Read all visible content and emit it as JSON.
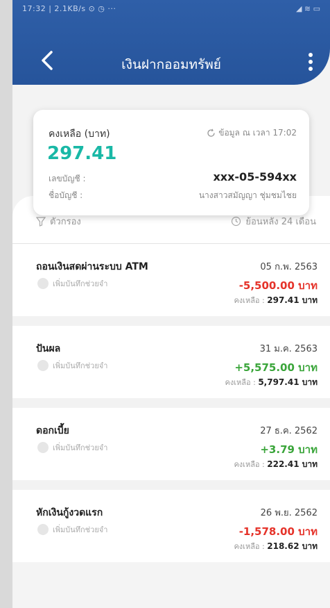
{
  "status_bar": {
    "left": "17:32 | 2.1KB/s ⊙ ◷ ···",
    "right": "◢ ≋ ▭"
  },
  "header": {
    "title": "เงินฝากออมทรัพย์"
  },
  "balance_card": {
    "label": "คงเหลือ (บาท)",
    "refresh_text": "ข้อมูล ณ เวลา 17:02",
    "amount": "297.41",
    "account_no_label": "เลขบัญชี :",
    "account_no": "xxx-05-594xx",
    "account_name_label": "ชื่อบัญชี :",
    "account_name": "นางสาวสมัญญา ชุ่มชมไชย"
  },
  "filters": {
    "filter_label": "ตัวกรอง",
    "period_label": "ย้อนหลัง 24 เดือน"
  },
  "transactions": [
    {
      "name": "ถอนเงินสดผ่านระบบ ATM",
      "date": "05 ก.พ. 2563",
      "note": "เพิ่มบันทึกช่วยจำ",
      "amount": "-5,500.00 บาท",
      "balance_label": "คงเหลือ :",
      "balance": "297.41 บาท",
      "direction": "debit"
    },
    {
      "name": "ปันผล",
      "date": "31 ม.ค. 2563",
      "note": "เพิ่มบันทึกช่วยจำ",
      "amount": "+5,575.00 บาท",
      "balance_label": "คงเหลือ :",
      "balance": "5,797.41 บาท",
      "direction": "credit"
    },
    {
      "name": "ดอกเบี้ย",
      "date": "27 ธ.ค. 2562",
      "note": "เพิ่มบันทึกช่วยจำ",
      "amount": "+3.79 บาท",
      "balance_label": "คงเหลือ :",
      "balance": "222.41 บาท",
      "direction": "credit"
    },
    {
      "name": "หักเงินกู้งวดแรก",
      "date": "26 พ.ย. 2562",
      "note": "เพิ่มบันทึกช่วยจำ",
      "amount": "-1,578.00 บาท",
      "balance_label": "คงเหลือ :",
      "balance": "218.62 บาท",
      "direction": "debit"
    }
  ],
  "colors": {
    "header": "#2f5fa8",
    "balance": "#19b8a6",
    "debit": "#e5332a",
    "credit": "#3aa53a"
  }
}
